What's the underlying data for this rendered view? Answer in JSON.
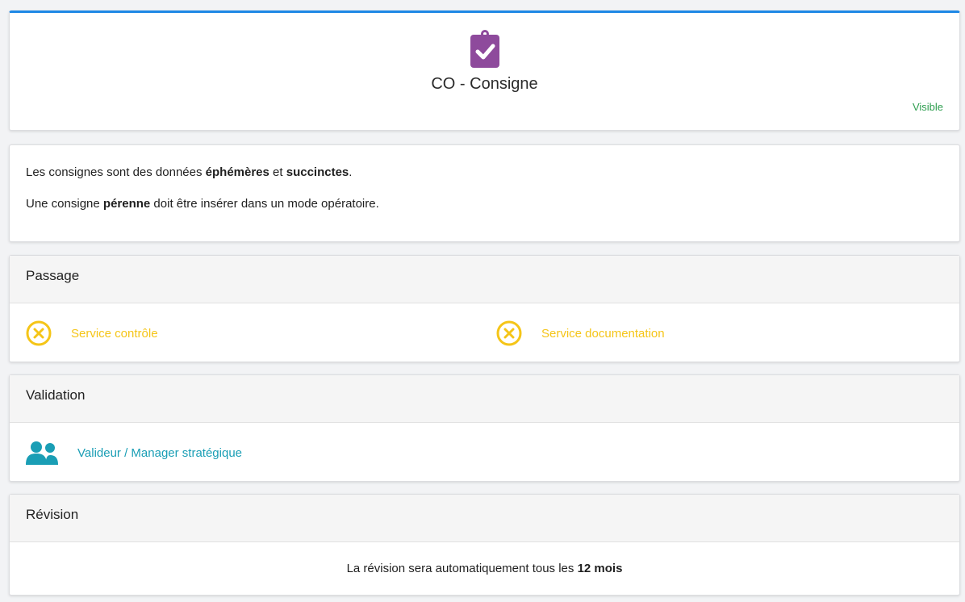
{
  "header": {
    "icon": "clipboard-check-icon",
    "title": "CO - Consigne",
    "visibility": "Visible",
    "colors": {
      "accent": "#1e88e5",
      "icon": "#8e4a9c",
      "visibility": "#2e9e4f"
    }
  },
  "info": {
    "line1": {
      "prefix": "Les consignes sont des données ",
      "bold1": "éphémères",
      "mid": " et ",
      "bold2": "succinctes",
      "suffix": "."
    },
    "line2": {
      "prefix": "Une consigne ",
      "bold": "pérenne",
      "suffix": " doit être insérer dans un mode opératoire."
    }
  },
  "passage": {
    "title": "Passage",
    "items": [
      {
        "icon": "x-circle-icon",
        "label": "Service contrôle",
        "color": "#f5c518"
      },
      {
        "icon": "x-circle-icon",
        "label": "Service documentation",
        "color": "#f5c518"
      }
    ]
  },
  "validation": {
    "title": "Validation",
    "validator": {
      "icon": "users-icon",
      "label": "Valideur / Manager stratégique",
      "color": "#1a9eb5"
    }
  },
  "revision": {
    "title": "Révision",
    "prefix": "La révision sera automatiquement tous les ",
    "bold": "12 mois"
  }
}
